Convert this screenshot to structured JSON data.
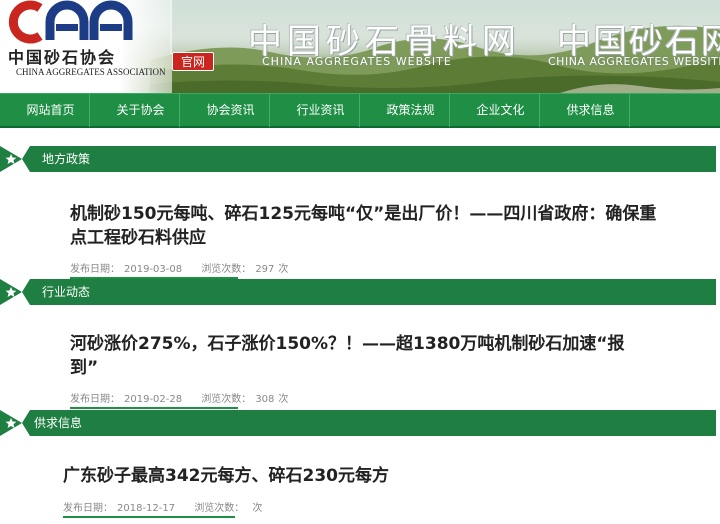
{
  "brand": {
    "logo_letters": "CAA",
    "logo_cn": "中国砂石协会",
    "logo_en": "CHINA AGGREGATES ASSOCIATION",
    "badge": "官网",
    "site_title_cn": "中国砂石骨料网",
    "site_title_en": "CHINA AGGREGATES WEBSITE",
    "site_title_cn2": "中国砂石网",
    "site_title_en2": "CHINA AGGREGATES WEBSITE"
  },
  "nav": {
    "items": [
      "网站首页",
      "关于协会",
      "协会资讯",
      "行业资讯",
      "政策法规",
      "企业文化",
      "供求信息"
    ]
  },
  "colors": {
    "nav_green": "#1f8f45",
    "section_green": "#1f7f42",
    "badge_red": "#c8261f"
  },
  "sections": [
    {
      "label": "地方政策",
      "title": "机制砂150元每吨、碎石125元每吨“仅”是出厂价！——四川省政府：确保重点工程砂石料供应",
      "date_label": "发布日期：",
      "date": "2019-03-08",
      "views_label": "浏览次数：",
      "views": "297",
      "views_unit": "次"
    },
    {
      "label": "行业动态",
      "title": "河砂涨价275%，石子涨价150%？！——超1380万吨机制砂石加速“报到”",
      "date_label": "发布日期：",
      "date": "2019-02-28",
      "views_label": "浏览次数：",
      "views": "308",
      "views_unit": "次"
    },
    {
      "label": "供求信息",
      "title": "广东砂子最高342元每方、碎石230元每方",
      "date_label": "发布日期：",
      "date": "2018-12-17",
      "views_label": "浏览次数：",
      "views": "",
      "views_unit": "次"
    }
  ]
}
